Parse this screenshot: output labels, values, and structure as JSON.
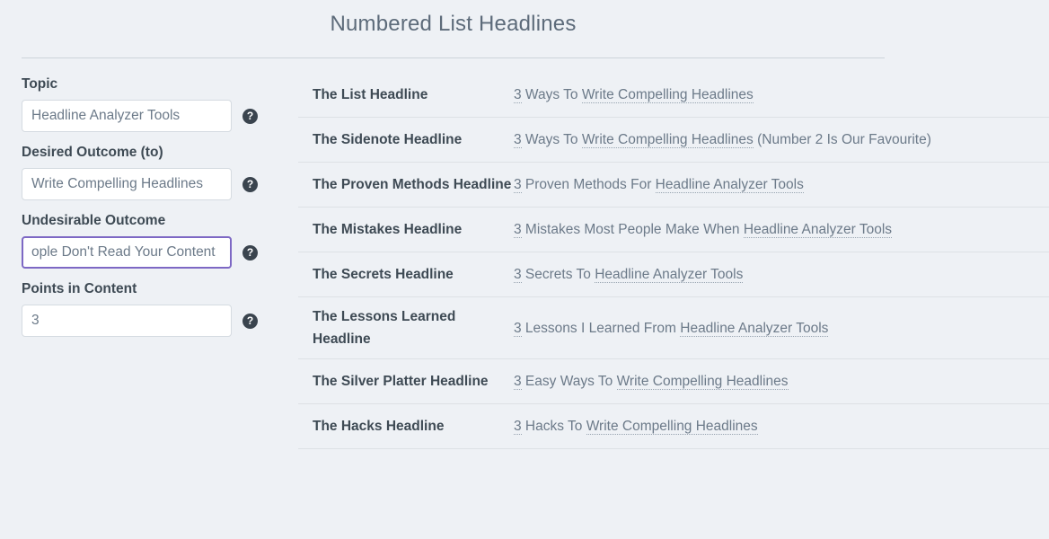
{
  "header": {
    "title": "Numbered List Headlines"
  },
  "form": {
    "help_icon_glyph": "?",
    "help_icon_name": "help-circle-icon",
    "accent_focus_color": "#7d68c4",
    "fields": [
      {
        "key": "topic",
        "label": "Topic",
        "value": "Headline Analyzer Tools",
        "focused": false
      },
      {
        "key": "desired_outcome",
        "label": "Desired Outcome (to)",
        "value": "Write Compelling Headlines",
        "focused": false
      },
      {
        "key": "undesirable_outcome",
        "label": "Undesirable Outcome",
        "value": "ople Don't Read Your Content",
        "full_value": "People Don't Read Your Content",
        "focused": true
      },
      {
        "key": "points_in_content",
        "label": "Points in Content",
        "value": "3",
        "focused": false
      }
    ]
  },
  "results": {
    "rows": [
      {
        "name": "The List Headline",
        "value": "3 Ways To Write Compelling Headlines",
        "parts": [
          {
            "t": "3",
            "var": true
          },
          {
            "t": " Ways To ",
            "var": false
          },
          {
            "t": "Write Compelling Headlines",
            "var": true
          }
        ]
      },
      {
        "name": "The Sidenote Headline",
        "value": "3 Ways To Write Compelling Headlines (Number 2 Is Our Favourite)",
        "parts": [
          {
            "t": "3",
            "var": true
          },
          {
            "t": " Ways To ",
            "var": false
          },
          {
            "t": "Write Compelling Headlines",
            "var": true
          },
          {
            "t": " (Number 2 Is Our Favourite)",
            "var": false
          }
        ]
      },
      {
        "name": "The Proven Methods Headline",
        "value": "3 Proven Methods For Headline Analyzer Tools",
        "parts": [
          {
            "t": "3",
            "var": true
          },
          {
            "t": " Proven Methods For ",
            "var": false
          },
          {
            "t": "Headline Analyzer Tools",
            "var": true
          }
        ]
      },
      {
        "name": "The Mistakes Headline",
        "value": "3 Mistakes Most People Make When Headline Analyzer Tools",
        "parts": [
          {
            "t": "3",
            "var": true
          },
          {
            "t": " Mistakes Most People Make When ",
            "var": false
          },
          {
            "t": "Headline Analyzer Tools",
            "var": true
          }
        ]
      },
      {
        "name": "The Secrets Headline",
        "value": "3 Secrets To Headline Analyzer Tools",
        "parts": [
          {
            "t": "3",
            "var": true
          },
          {
            "t": " Secrets To ",
            "var": false
          },
          {
            "t": "Headline Analyzer Tools",
            "var": true
          }
        ]
      },
      {
        "name": "The Lessons Learned Headline",
        "value": "3 Lessons I Learned From Headline Analyzer Tools",
        "parts": [
          {
            "t": "3",
            "var": true
          },
          {
            "t": " Lessons I Learned From ",
            "var": false
          },
          {
            "t": "Headline Analyzer Tools",
            "var": true
          }
        ]
      },
      {
        "name": "The Silver Platter Headline",
        "value": "3 Easy Ways To Write Compelling Headlines",
        "parts": [
          {
            "t": "3",
            "var": true
          },
          {
            "t": " Easy Ways To ",
            "var": false
          },
          {
            "t": "Write Compelling Headlines",
            "var": true
          }
        ]
      },
      {
        "name": "The Hacks Headline",
        "value": "3 Hacks To Write Compelling Headlines",
        "parts": [
          {
            "t": "3",
            "var": true
          },
          {
            "t": " Hacks To ",
            "var": false
          },
          {
            "t": "Write Compelling Headlines",
            "var": true
          }
        ]
      }
    ]
  }
}
